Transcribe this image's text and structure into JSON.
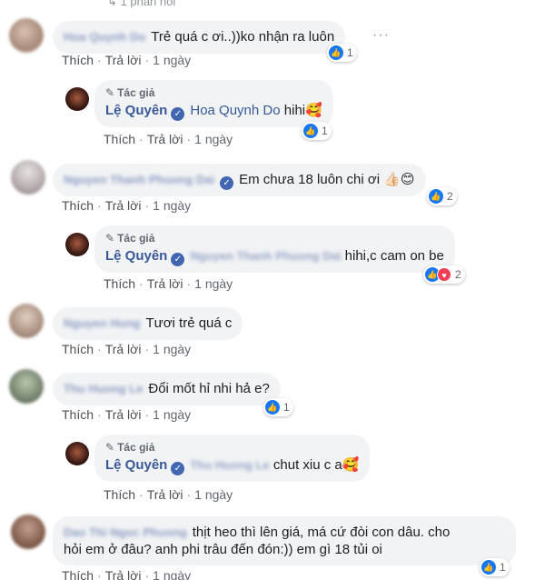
{
  "header_cut": "1 phản hồi",
  "actions": {
    "like": "Thích",
    "reply": "Trả lời"
  },
  "author_tag": "Tác giả",
  "comments": [
    {
      "name": "Hoa Quynh Do",
      "text": "Trẻ quá c ơi..))ko nhận ra luôn",
      "time": "1 ngày",
      "reaction_count": "1",
      "reaction": "like"
    },
    {
      "name": "Lệ Quyên",
      "mention": "Hoa Quynh Do",
      "text": "hihi🥰",
      "time": "1 ngày",
      "reaction_count": "1",
      "reaction": "like",
      "is_author": true
    },
    {
      "name": "Nguyen Thanh Phuong Dai",
      "text": "Em chưa 18 luôn chi ơi 👍🏻😊",
      "time": "1 ngày",
      "reaction_count": "2",
      "reaction": "like"
    },
    {
      "name": "Lệ Quyên",
      "mention": "Nguyen Thanh Phuong Dai",
      "text": "hihi,c cam on be",
      "time": "1 ngày",
      "reaction_count": "2",
      "reaction": "like+love",
      "is_author": true
    },
    {
      "name": "Nguyen Hung",
      "text": "Tươi trẻ quá c",
      "time": "1 ngày"
    },
    {
      "name": "Thu Huong Le",
      "text": "Đổi mốt hỉ nhi hả e?",
      "time": "1 ngày",
      "reaction_count": "1",
      "reaction": "like"
    },
    {
      "name": "Lệ Quyên",
      "mention": "Thu Huong Le",
      "text": "chut xiu c a🥰",
      "time": "1 ngày",
      "is_author": true
    },
    {
      "name": "Dao Thi Ngoc Phuong",
      "text_line1": "thịt heo thì lên giá, má cứ đòi con dâu. cho",
      "text_line2": "hỏi em ở đâu? anh phi trâu đến đón:)) em gì 18 tủi oi",
      "time": "1 ngày",
      "reaction_count": "1",
      "reaction": "like"
    }
  ],
  "colors": {
    "link": "#385898",
    "bubble": "#f2f3f5",
    "like": "#1877f2",
    "love": "#f33e58"
  }
}
